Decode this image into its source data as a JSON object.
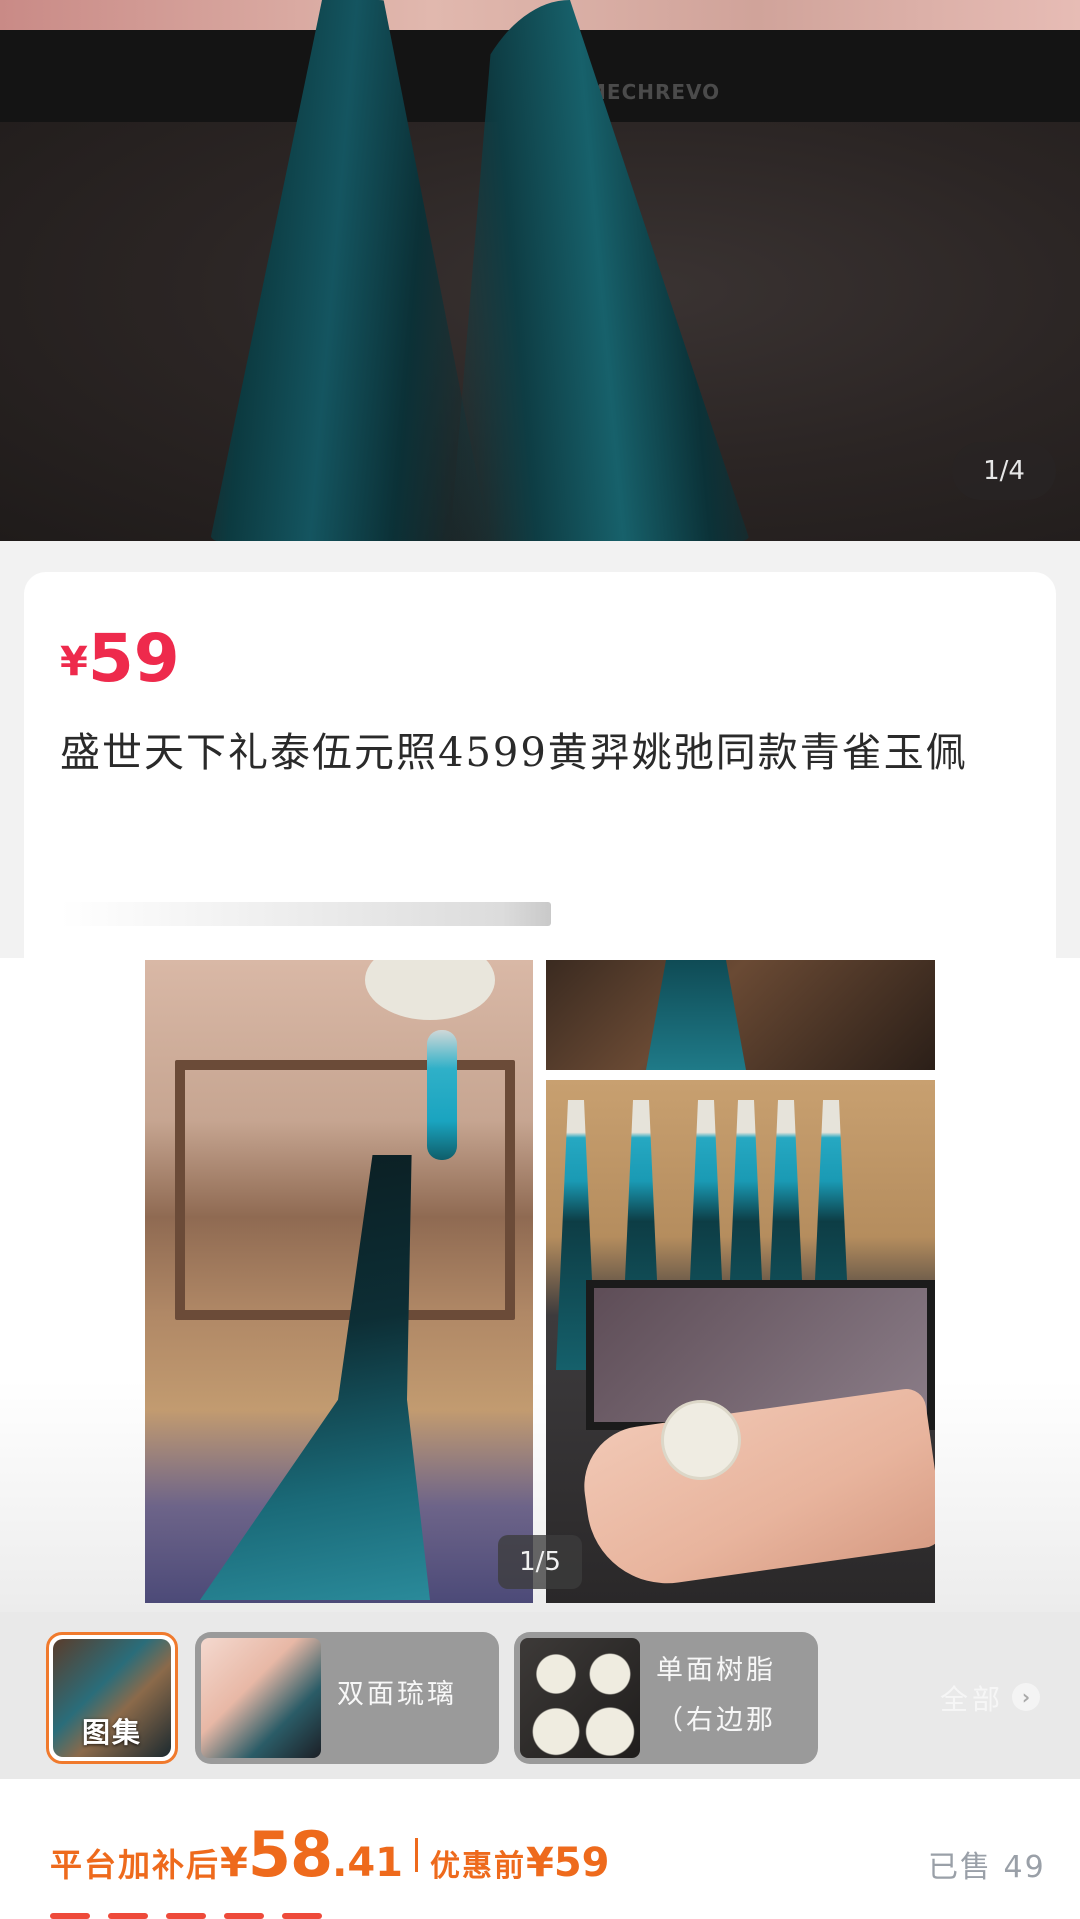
{
  "hero": {
    "brand": "MECHREVO",
    "counter": "1/4"
  },
  "product": {
    "currency": "¥",
    "price": "59",
    "title": "盛世天下礼泰伍元照4599黄羿姚弛同款青雀玉佩"
  },
  "gallery": {
    "counter": "1/5"
  },
  "styles": {
    "options": [
      {
        "label": "图集"
      },
      {
        "label": "双面琉璃"
      },
      {
        "label": "单面树脂（右边那"
      }
    ],
    "all_label": "全部"
  },
  "bottom": {
    "subsidy_label": "平台加补后",
    "subsidy_currency": "¥",
    "subsidy_int": "58",
    "subsidy_dec": ".41",
    "before_label": "优惠前",
    "before_price": "¥59",
    "sold_label": "已售",
    "sold_count": "49"
  },
  "colors": {
    "price_red": "#ee2a4c",
    "accent_orange": "#ee6a1c",
    "selected_border": "#f07a2d"
  }
}
